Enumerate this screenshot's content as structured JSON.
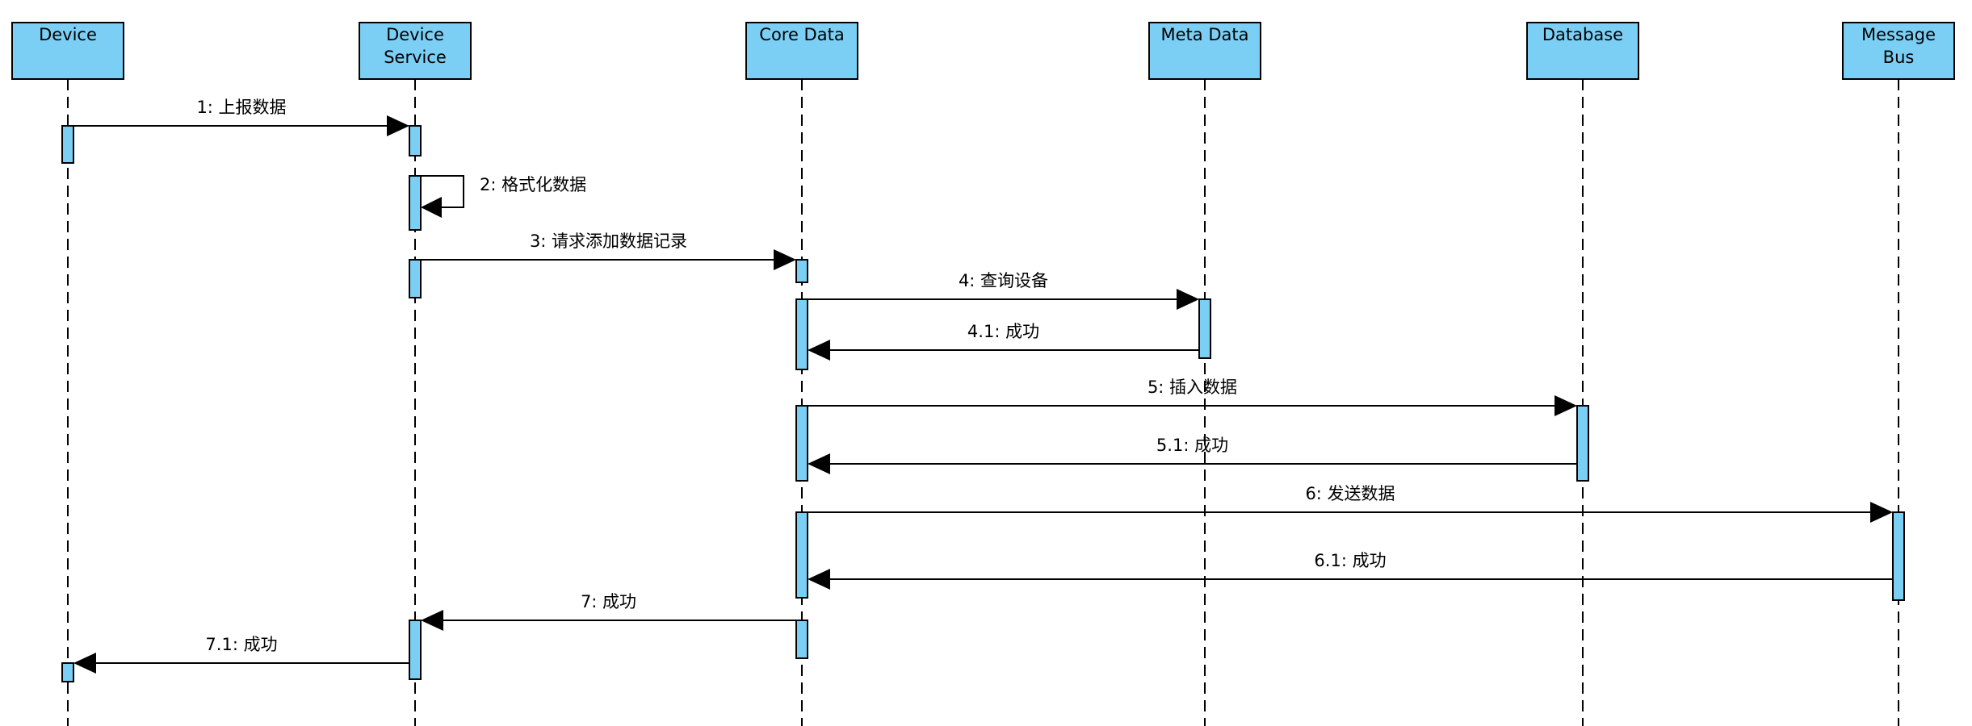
{
  "diagram": {
    "type": "sequence",
    "colors": {
      "participant_fill": "#7ccff4",
      "activation_fill": "#7ccff4",
      "stroke": "#000000",
      "background": "#ffffff"
    },
    "participants": [
      {
        "id": "device",
        "lines": [
          "Device"
        ]
      },
      {
        "id": "device-service",
        "lines": [
          "Device",
          "Service"
        ]
      },
      {
        "id": "core-data",
        "lines": [
          "Core Data"
        ]
      },
      {
        "id": "meta-data",
        "lines": [
          "Meta Data"
        ]
      },
      {
        "id": "database",
        "lines": [
          "Database"
        ]
      },
      {
        "id": "message-bus",
        "lines": [
          "Message",
          "Bus"
        ]
      }
    ],
    "messages": [
      {
        "label": "1: 上报数据",
        "from": "device",
        "to": "device-service"
      },
      {
        "label": "2: 格式化数据",
        "from": "device-service",
        "to": "device-service"
      },
      {
        "label": "3: 请求添加数据记录",
        "from": "device-service",
        "to": "core-data"
      },
      {
        "label": "4: 查询设备",
        "from": "core-data",
        "to": "meta-data"
      },
      {
        "label": "4.1: 成功",
        "from": "meta-data",
        "to": "core-data"
      },
      {
        "label": "5: 插入数据",
        "from": "core-data",
        "to": "database"
      },
      {
        "label": "5.1: 成功",
        "from": "database",
        "to": "core-data"
      },
      {
        "label": "6: 发送数据",
        "from": "core-data",
        "to": "message-bus"
      },
      {
        "label": "6.1: 成功",
        "from": "message-bus",
        "to": "core-data"
      },
      {
        "label": "7: 成功",
        "from": "core-data",
        "to": "device-service"
      },
      {
        "label": "7.1: 成功",
        "from": "device-service",
        "to": "device"
      }
    ]
  }
}
